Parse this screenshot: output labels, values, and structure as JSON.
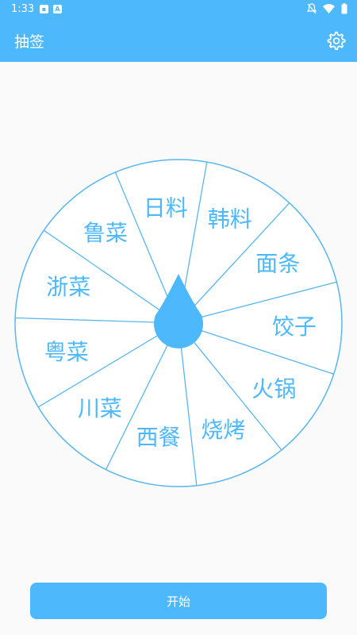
{
  "status_bar": {
    "time": "1:33"
  },
  "app_bar": {
    "title": "抽签"
  },
  "wheel": {
    "items": [
      "韩料",
      "面条",
      "饺子",
      "火锅",
      "烧烤",
      "西餐",
      "川菜",
      "粤菜",
      "浙菜",
      "鲁菜",
      "日料"
    ],
    "accent": "#4db8fb",
    "line": "#5ab6ee"
  },
  "start_button": {
    "label": "开始"
  }
}
